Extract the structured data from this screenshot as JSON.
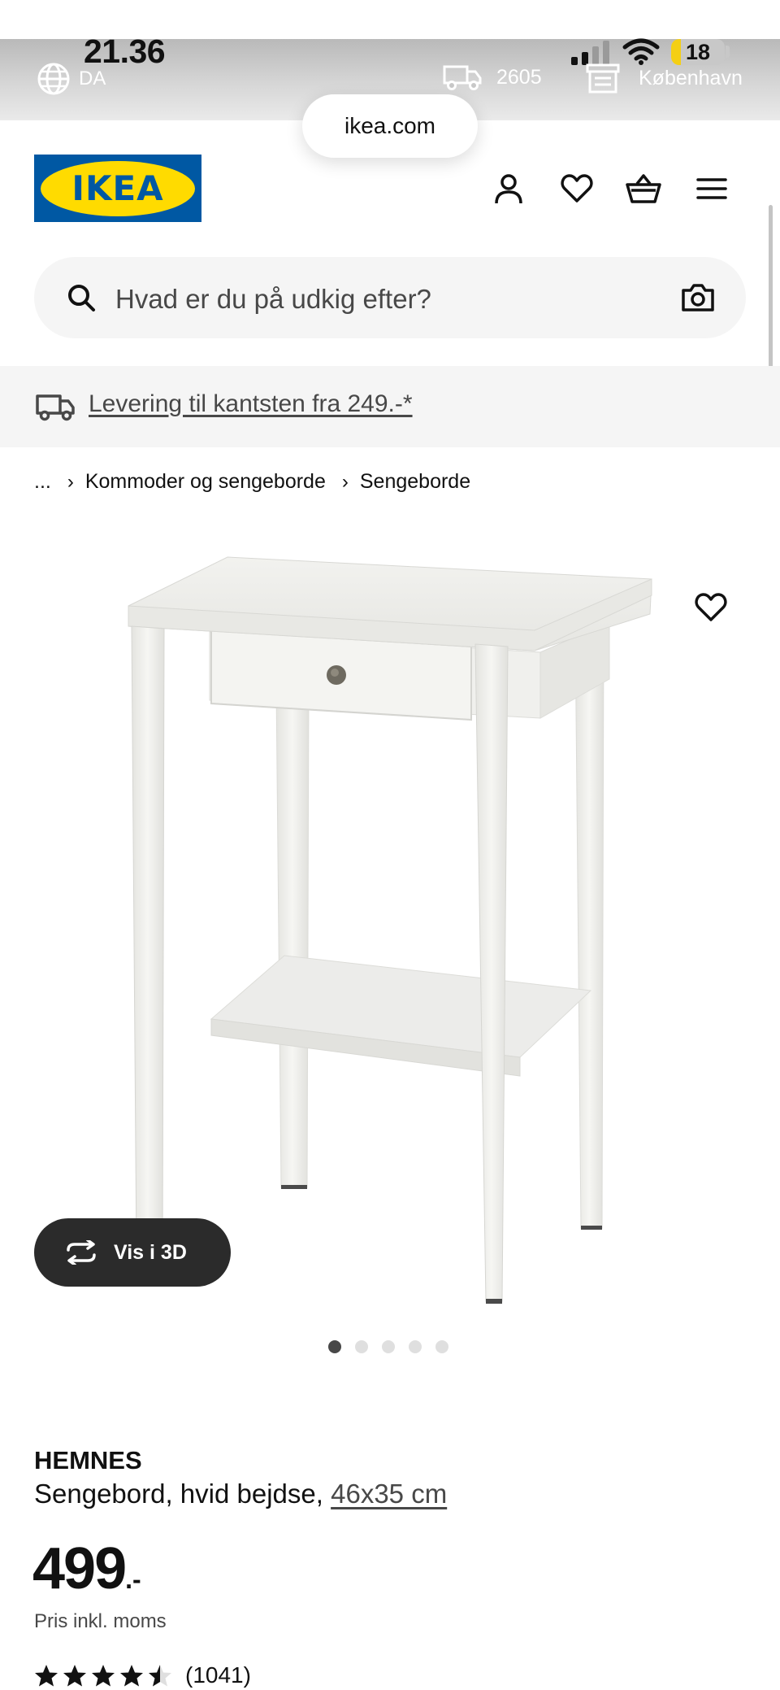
{
  "status_bar": {
    "time": "21.36",
    "battery_level": 18,
    "battery_label": "18"
  },
  "top_strip": {
    "language": "DA",
    "zip_code": "2605",
    "store": "København"
  },
  "browser": {
    "url": "ikea.com"
  },
  "header": {
    "logo_text": "IKEA",
    "icons": [
      "profile-icon",
      "heart-icon",
      "basket-icon",
      "menu-icon"
    ]
  },
  "search": {
    "placeholder": "Hvad er du på udkig efter?"
  },
  "delivery_banner": {
    "text": "Levering til kantsten fra 249.-*"
  },
  "breadcrumb": {
    "ellipsis": "...",
    "items": [
      "Kommoder og sengeborde",
      "Sengeborde"
    ]
  },
  "product": {
    "view_3d_label": "Vis i 3D",
    "image_count": 5,
    "active_image": 1,
    "name": "HEMNES",
    "description": "Sengebord, hvid bejdse,",
    "size": "46x35 cm",
    "price": "499",
    "price_suffix": ".-",
    "price_note": "Pris inkl. moms",
    "rating": 4.5,
    "review_count": "(1041)"
  },
  "colors": {
    "ikea_blue": "#0058a3",
    "ikea_yellow": "#ffdb00",
    "text_dark": "#111111",
    "text_muted": "#484848",
    "surface_gray": "#f5f5f5",
    "battery_yellow": "#f4cf14"
  }
}
